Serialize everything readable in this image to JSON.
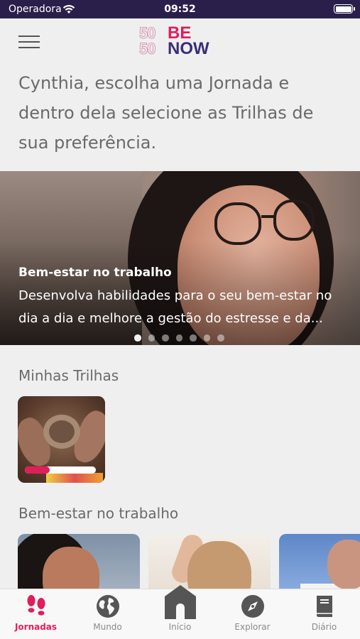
{
  "status_bar": {
    "carrier": "Operadora",
    "time": "09:52"
  },
  "header": {
    "logo": {
      "number_top": "50",
      "number_bottom": "50",
      "word_top": "BE",
      "word_bottom": "NOW"
    }
  },
  "intro": {
    "text": "Cynthia, escolha uma Jornada e dentro dela selecione as Trilhas de sua preferência."
  },
  "carousel": {
    "title": "Bem-estar no trabalho",
    "description": "Desenvolva habilidades para o seu bem-estar no dia a dia e melhore a gestão do estresse e da...",
    "slide_count": 7,
    "active_slide": 1
  },
  "minhas_trilhas": {
    "title": "Minhas Trilhas",
    "cards": [
      {
        "progress_fraction": 0.35
      }
    ]
  },
  "bem_estar": {
    "title": "Bem-estar no trabalho"
  },
  "tab_bar": {
    "tabs": [
      {
        "label": "Jornadas",
        "icon": "footprints-icon",
        "active": true
      },
      {
        "label": "Mundo",
        "icon": "globe-icon",
        "active": false
      },
      {
        "label": "Início",
        "icon": "home-icon",
        "active": false
      },
      {
        "label": "Explorar",
        "icon": "compass-icon",
        "active": false
      },
      {
        "label": "Diário",
        "icon": "book-icon",
        "active": false
      }
    ]
  },
  "colors": {
    "accent": "#e01e5a",
    "brand_dark": "#3a2e78",
    "status_bar": "#2a1f4a",
    "inactive_icon": "#555555"
  }
}
